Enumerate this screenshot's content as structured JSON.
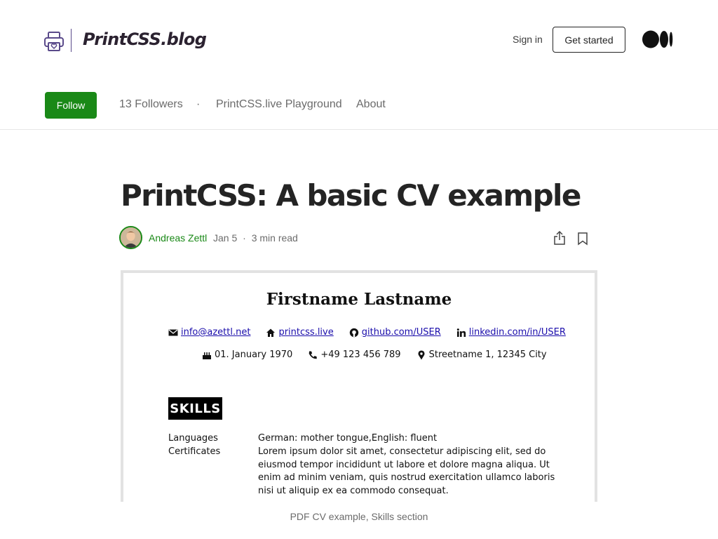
{
  "header": {
    "blog_title": "PrintCSS.blog",
    "sign_in": "Sign in",
    "get_started": "Get started"
  },
  "nav": {
    "follow": "Follow",
    "followers": "13 Followers",
    "separator": "·",
    "playground": "PrintCSS.live Playground",
    "about": "About"
  },
  "article": {
    "title": "PrintCSS: A basic CV example",
    "author": "Andreas Zettl",
    "date": "Jan 5",
    "meta_separator": "·",
    "read_time": "3 min read",
    "caption": "PDF CV example, Skills section"
  },
  "cv": {
    "name": "Firstname Lastname",
    "email": "info@azettl.net",
    "website": "printcss.live",
    "github": "github.com/USER",
    "linkedin": "linkedin.com/in/USER",
    "birthday": "01. January 1970",
    "phone": "+49 123 456 789",
    "address": "Streetname 1, 12345 City",
    "skills_heading": "SKILLS",
    "rows": [
      {
        "label": "Languages",
        "value": "German: mother tongue,English: fluent"
      },
      {
        "label": "Certificates",
        "value": "Lorem ipsum dolor sit amet, consectetur adipiscing elit, sed do eiusmod tempor incididunt ut labore et dolore magna aliqua. Ut enim ad minim veniam, quis nostrud exercitation ullamco laboris nisi ut aliquip ex ea commodo consequat."
      }
    ]
  },
  "colors": {
    "accent_green": "#1a8917",
    "text_dark": "#242424",
    "text_muted": "#6b6b6b",
    "logo_purple": "#5a4a8a",
    "cv_link": "#1a0dab"
  },
  "icons": [
    "printer-heart-icon",
    "medium-logo",
    "share-icon",
    "bookmark-icon",
    "envelope-icon",
    "home-icon",
    "github-icon",
    "linkedin-icon",
    "cake-icon",
    "phone-icon",
    "map-pin-icon"
  ]
}
